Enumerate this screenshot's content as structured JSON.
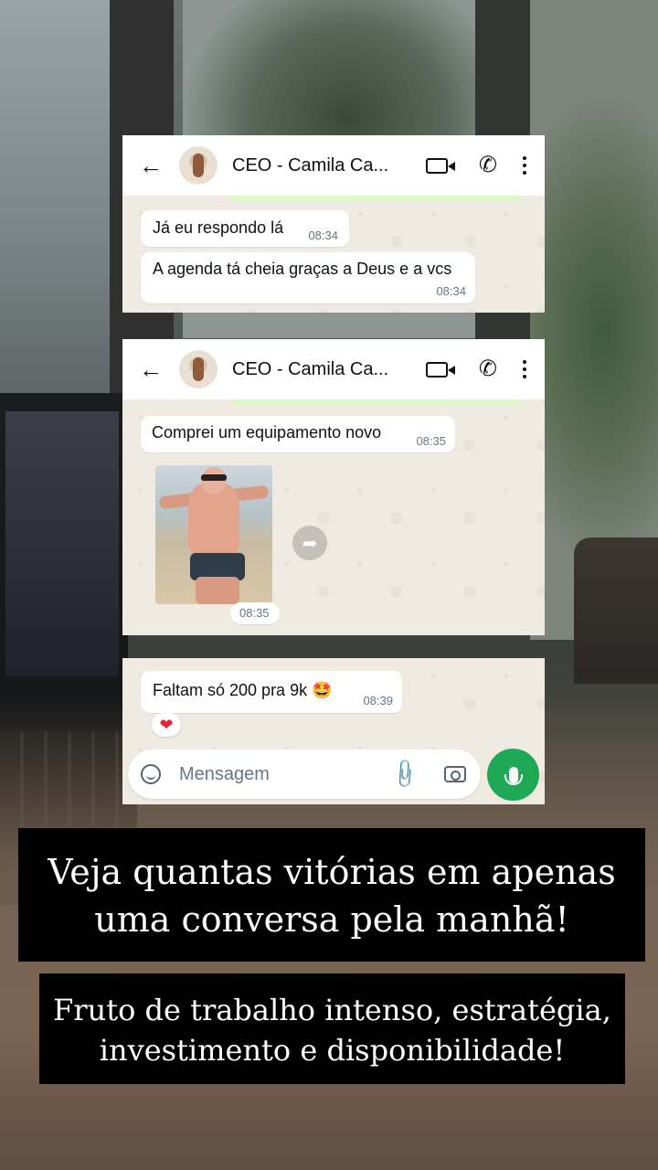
{
  "contact_name": "CEO - Camila Ca...",
  "messages": [
    {
      "text": "Já eu respondo lá",
      "time": "08:34"
    },
    {
      "text": "A agenda tá cheia graças a Deus e a vcs",
      "time": "08:34"
    },
    {
      "text": "Comprei um equipamento novo",
      "time": "08:35"
    },
    {
      "time": "08:35"
    },
    {
      "text": "Faltam só 200 pra 9k 🤩",
      "time": "08:39"
    }
  ],
  "reaction": "❤",
  "composer": {
    "placeholder": "Mensagem"
  },
  "captions": {
    "headline_1": "Veja quantas vitórias em apenas",
    "headline_2": "uma conversa pela manhã!",
    "sub_1": "Fruto de trabalho intenso, estratégia,",
    "sub_2": "investimento e disponibilidade!"
  },
  "colors": {
    "accent_green": "#1fa855",
    "chat_bg": "#efeae2",
    "bubble": "#ffffff"
  }
}
